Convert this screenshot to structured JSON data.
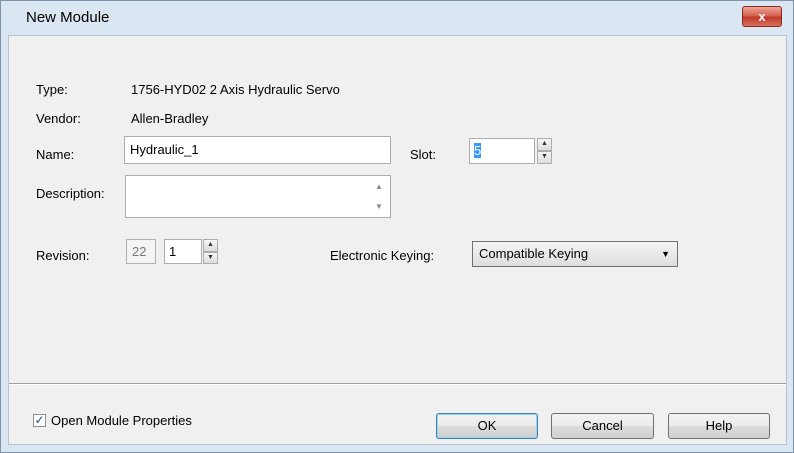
{
  "window": {
    "title": "New Module",
    "close_glyph": "x"
  },
  "fields": {
    "type_label": "Type:",
    "type_value": "1756-HYD02 2 Axis Hydraulic Servo",
    "vendor_label": "Vendor:",
    "vendor_value": "Allen-Bradley",
    "name_label": "Name:",
    "name_value": "Hydraulic_1",
    "slot_label": "Slot:",
    "slot_value": "5",
    "description_label": "Description:",
    "description_value": "",
    "revision_label": "Revision:",
    "revision_major": "22",
    "revision_minor": "1",
    "keying_label": "Electronic Keying:",
    "keying_value": "Compatible Keying"
  },
  "footer": {
    "open_props_label": "Open Module Properties",
    "open_props_checked": true,
    "ok_label": "OK",
    "cancel_label": "Cancel",
    "help_label": "Help"
  }
}
